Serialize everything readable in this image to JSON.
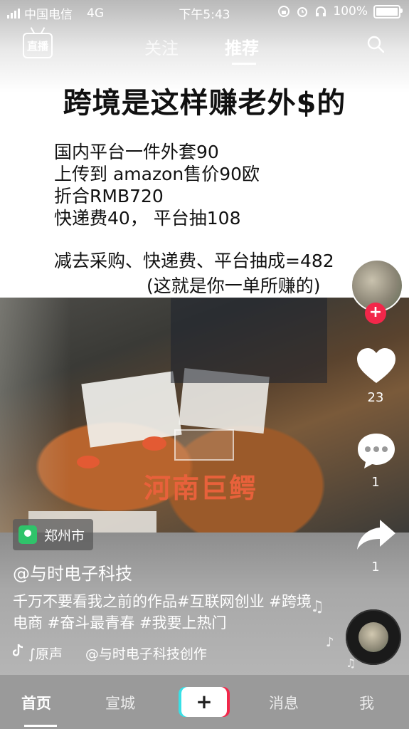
{
  "status_bar": {
    "carrier": "中国电信",
    "network": "4G",
    "time": "下午5:43",
    "battery": "100%"
  },
  "top_nav": {
    "live_label": "直播",
    "tab_follow": "关注",
    "tab_recommend": "推荐"
  },
  "graphic": {
    "headline": "跨境是这样赚老外$的",
    "lines": [
      "国内平台一件外套90",
      "上传到 amazon售价90欧",
      "折合RMB720",
      "快递费40，  平台抽108"
    ],
    "calc": "减去采购、快递费、平台抽成=482",
    "calc_note": "(这就是你一单所赚的)"
  },
  "video": {
    "watermark": "河南巨鳄"
  },
  "rail": {
    "likes": "23",
    "comments": "1",
    "shares": "1"
  },
  "post": {
    "location": "郑州市",
    "author": "@与时电子科技",
    "caption": "千万不要看我之前的作品#互联网创业 #跨境电商 #奋斗最青春 #我要上热门",
    "music_prefix": "∫原声",
    "music_author": "@与时电子科技创作"
  },
  "tab_bar": {
    "home": "首页",
    "city": "宣城",
    "plus": "+",
    "messages": "消息",
    "me": "我"
  },
  "colors": {
    "accent_red": "#f2274a",
    "accent_cyan": "#38e0e6",
    "location_green": "#2fc36a",
    "watermark": "#e8613b"
  },
  "icons": [
    "live-icon",
    "search-icon",
    "heart-icon",
    "comment-icon",
    "share-icon",
    "location-icon",
    "music-note-icon",
    "tiktok-logo-icon"
  ]
}
